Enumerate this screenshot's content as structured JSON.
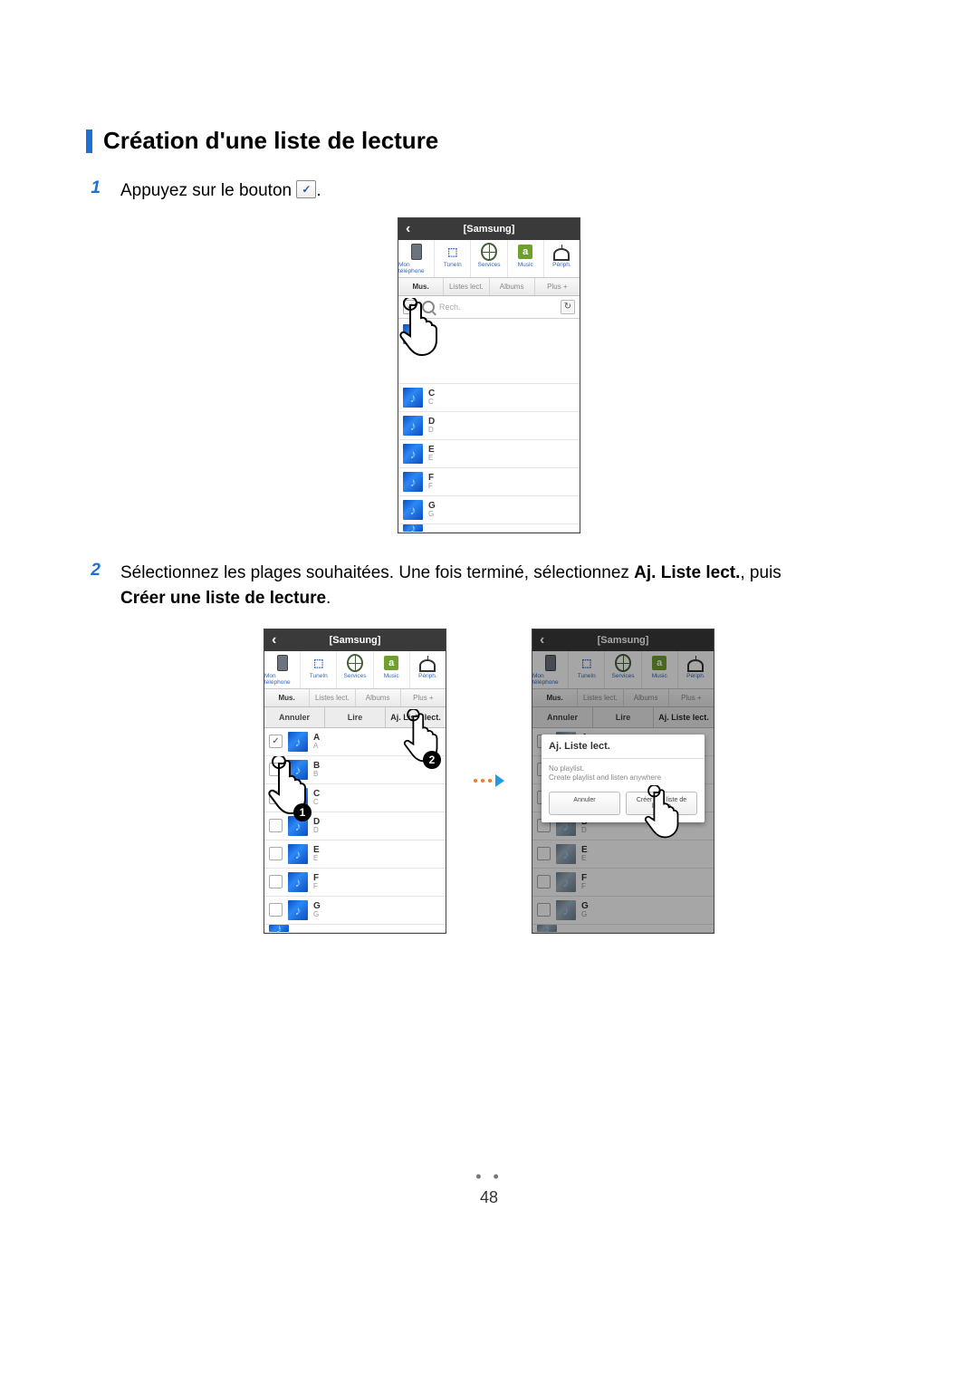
{
  "heading": "Création d'une liste de lecture",
  "steps": {
    "one": {
      "num": "1",
      "text_before": "Appuyez sur le bouton ",
      "text_after": "."
    },
    "two": {
      "num": "2",
      "text_a": "Sélectionnez les plages souhaitées. Une fois terminé, sélectionnez ",
      "bold_a": "Aj. Liste lect.",
      "text_b": ", puis ",
      "bold_b": "Créer une liste de lecture",
      "text_c": "."
    }
  },
  "phone_common": {
    "title": "[Samsung]",
    "sources": {
      "mon_telephone": "Mon téléphone",
      "tunein": "TuneIn",
      "services": "Services",
      "music": "Music",
      "periph": "Périph."
    },
    "tabs": {
      "mus": "Mus.",
      "listes": "Listes lect.",
      "albums": "Albums",
      "plus": "Plus +"
    },
    "search_placeholder": "Rech.",
    "tracks": {
      "a": {
        "title": "A",
        "sub": "A"
      },
      "b": {
        "title": "B",
        "sub": "B"
      },
      "c": {
        "title": "C",
        "sub": "C"
      },
      "d": {
        "title": "D",
        "sub": "D"
      },
      "e": {
        "title": "E",
        "sub": "E"
      },
      "f": {
        "title": "F",
        "sub": "F"
      },
      "g": {
        "title": "G",
        "sub": "G"
      }
    }
  },
  "actions": {
    "annuler": "Annuler",
    "lire": "Lire",
    "aj": "Aj. Liste lect."
  },
  "modal": {
    "title": "Aj. Liste lect.",
    "body_line1": "No playlist.",
    "body_line2": "Create playlist and listen anywhere",
    "btn_cancel": "Annuler",
    "btn_create": "Créer une liste de lecture"
  },
  "page_number": "48"
}
